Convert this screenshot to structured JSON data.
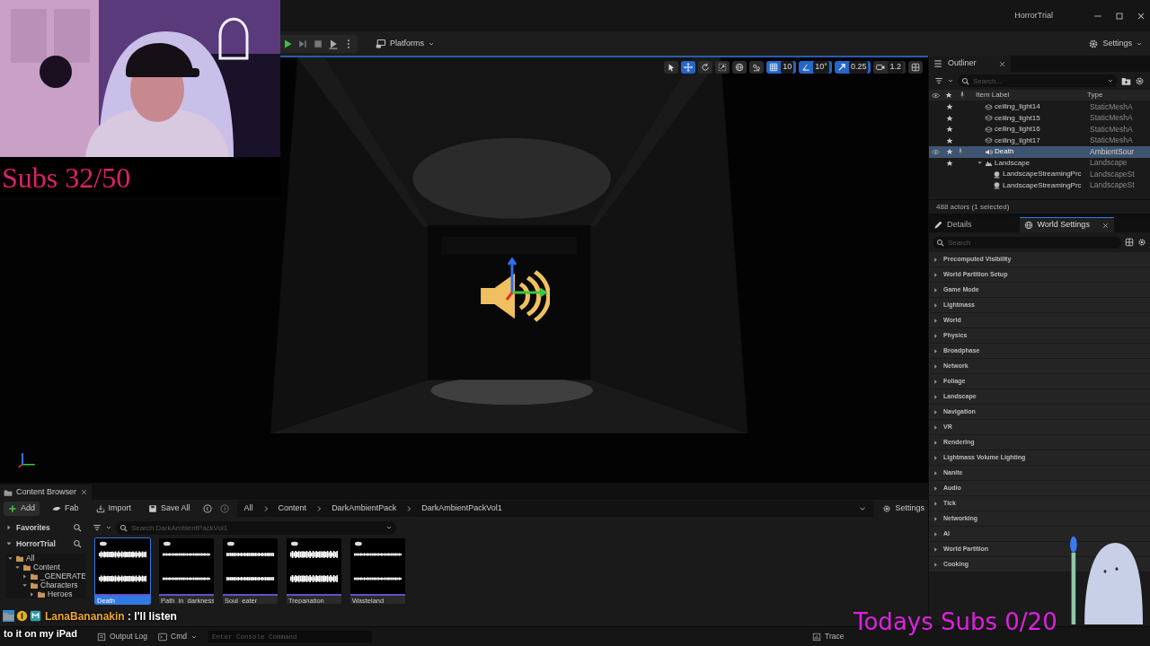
{
  "window": {
    "title": "HorrorTrial"
  },
  "toolbar": {
    "platforms": "Platforms",
    "settings": "Settings"
  },
  "viewport": {
    "tools": [
      {
        "kind": "select",
        "on": false
      },
      {
        "kind": "move",
        "on": true
      },
      {
        "kind": "rotate",
        "on": false
      },
      {
        "kind": "scale",
        "on": false
      },
      {
        "kind": "world",
        "on": false
      },
      {
        "kind": "surface",
        "on": false
      },
      {
        "kind": "grid",
        "on": true,
        "value": "10"
      },
      {
        "kind": "angle",
        "on": true,
        "value": "10°"
      },
      {
        "kind": "scale_snap",
        "on": true,
        "value": "0.25"
      },
      {
        "kind": "camera",
        "on": false,
        "value": "1.2"
      },
      {
        "kind": "layout",
        "on": false
      }
    ]
  },
  "outliner": {
    "title": "Outliner",
    "search_placeholder": "Search...",
    "columns": [
      "Item Label",
      "Type"
    ],
    "rows": [
      {
        "kind": "mesh",
        "label": "ceiling_light14",
        "type": "StaticMeshA",
        "selected": false
      },
      {
        "kind": "mesh",
        "label": "ceiling_light15",
        "type": "StaticMeshA",
        "selected": false
      },
      {
        "kind": "mesh",
        "label": "ceiling_light16",
        "type": "StaticMeshA",
        "selected": false
      },
      {
        "kind": "mesh",
        "label": "ceiling_light17",
        "type": "StaticMeshA",
        "selected": false
      },
      {
        "kind": "sound",
        "label": "Death",
        "type": "AmbientSour",
        "selected": true
      },
      {
        "kind": "landscape",
        "label": "Landscape",
        "type": "Landscape",
        "selected": false,
        "expanded": true,
        "children": [
          {
            "kind": "proxy",
            "label": "LandscapeStreamingPrc",
            "type": "LandscapeSt",
            "selected": false
          },
          {
            "kind": "proxy",
            "label": "LandscapeStreamingPrc",
            "type": "LandscapeSt",
            "selected": false
          }
        ]
      }
    ],
    "footer": "488 actors (1 selected)"
  },
  "details": {
    "tabs": [
      {
        "label": "Details",
        "selected": false
      },
      {
        "label": "World Settings",
        "selected": true
      }
    ],
    "search_placeholder": "Search",
    "categories": [
      "Precomputed Visibility",
      "World Partition Setup",
      "Game Mode",
      "Lightmass",
      "World",
      "Physics",
      "Broadphase",
      "Network",
      "Foliage",
      "Landscape",
      "Navigation",
      "VR",
      "Rendering",
      "Lightmass Volume Lighting",
      "Nanite",
      "Audio",
      "Tick",
      "Networking",
      "AI",
      "World Partition",
      "Cooking"
    ]
  },
  "content_browser": {
    "tab": "Content Browser",
    "buttons": [
      {
        "kind": "add",
        "label": "Add"
      },
      {
        "kind": "fab",
        "label": "Fab"
      },
      {
        "kind": "import",
        "label": "Import"
      },
      {
        "kind": "save",
        "label": "Save All"
      }
    ],
    "path": [
      "All",
      "Content",
      "DarkAmbientPack",
      "DarkAmbientPackVol1"
    ],
    "settings": "Settings",
    "favorites": "Favorites",
    "project": "HorrorTrial",
    "tree": [
      {
        "label": "All",
        "expanded": true,
        "children": [
          {
            "label": "Content",
            "expanded": true,
            "children": [
              {
                "label": "_GENERATE",
                "expanded": false
              },
              {
                "label": "Characters",
                "expanded": true,
                "children": [
                  {
                    "label": "Heroes",
                    "expanded": false
                  }
                ]
              }
            ]
          }
        ]
      }
    ],
    "search_placeholder": "Search DarkAmbientPackVol1",
    "assets": [
      {
        "name": "Death",
        "selected": true
      },
      {
        "name": "Path_in_darkness",
        "selected": false
      },
      {
        "name": "Soul_eater",
        "selected": false
      },
      {
        "name": "Trepanation",
        "selected": false
      },
      {
        "name": "Wasteland",
        "selected": false
      }
    ]
  },
  "status_bar": {
    "items": [
      {
        "kind": "log",
        "label": "Output Log"
      },
      {
        "kind": "cmd",
        "label": "Cmd"
      }
    ],
    "console_placeholder": "Enter Console Command",
    "trace": "Trace"
  },
  "overlay": {
    "subs_total": "Subs 32/50",
    "subs_today": "Todays Subs 0/20",
    "chat": {
      "user": "LanaBananakin",
      "message_lines": [
        ": I'll listen",
        "to it on my iPad"
      ]
    }
  }
}
